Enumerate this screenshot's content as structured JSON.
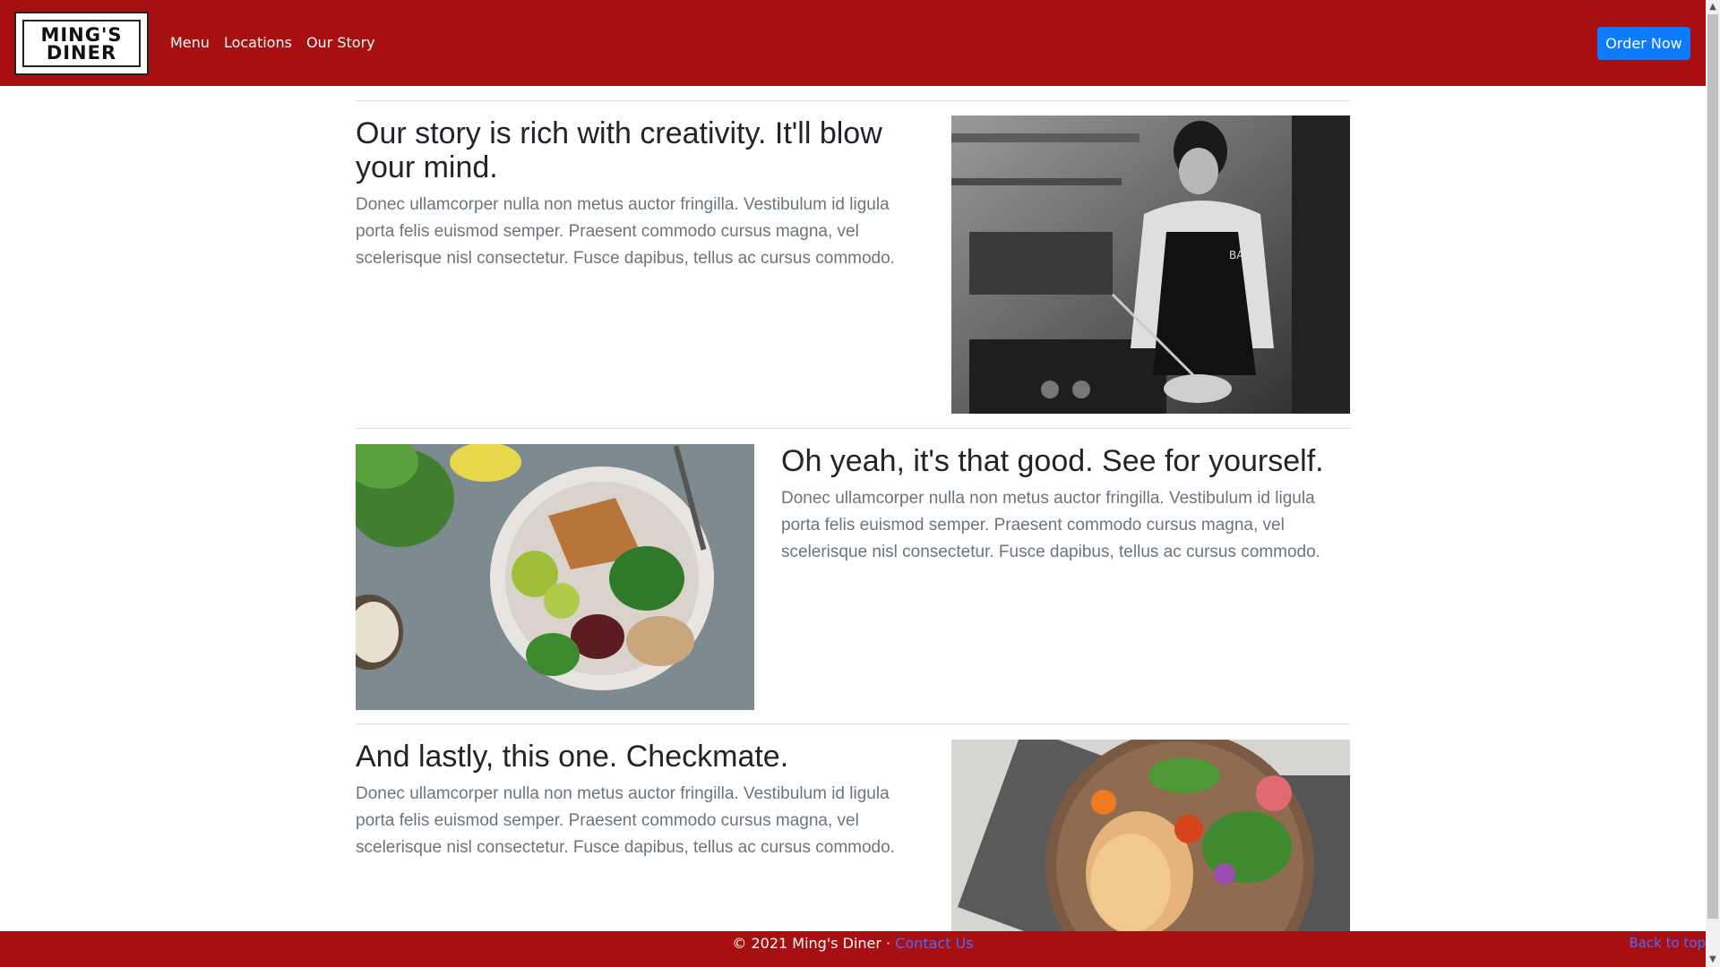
{
  "header": {
    "logo_text_line1": "MING'S",
    "logo_text_line2": "DINER",
    "nav": [
      "Menu",
      "Locations",
      "Our Story"
    ],
    "order_button": "Order Now"
  },
  "features": [
    {
      "heading": "Our story is rich with creativity. It'll blow your mind.",
      "text": "Donec ullamcorper nulla non metus auctor fringilla. Vestibulum id ligula porta felis euismod semper. Praesent commodo cursus magna, vel scelerisque nisl consectetur. Fusce dapibus, tellus ac cursus commodo."
    },
    {
      "heading": "Oh yeah, it's that good. See for yourself.",
      "text": "Donec ullamcorper nulla non metus auctor fringilla. Vestibulum id ligula porta felis euismod semper. Praesent commodo cursus magna, vel scelerisque nisl consectetur. Fusce dapibus, tellus ac cursus commodo."
    },
    {
      "heading": "And lastly, this one. Checkmate.",
      "text": "Donec ullamcorper nulla non metus auctor fringilla. Vestibulum id ligula porta felis euismod semper. Praesent commodo cursus magna, vel scelerisque nisl consectetur. Fusce dapibus, tellus ac cursus commodo."
    }
  ],
  "footer": {
    "copyright": "© 2021 Ming's Diner · ",
    "contact_link": "Contact Us",
    "back_to_top": "Back to top"
  },
  "colors": {
    "brand_red": "#a80f10",
    "primary_blue": "#0d7bff",
    "link_blue": "#4b6bff"
  }
}
